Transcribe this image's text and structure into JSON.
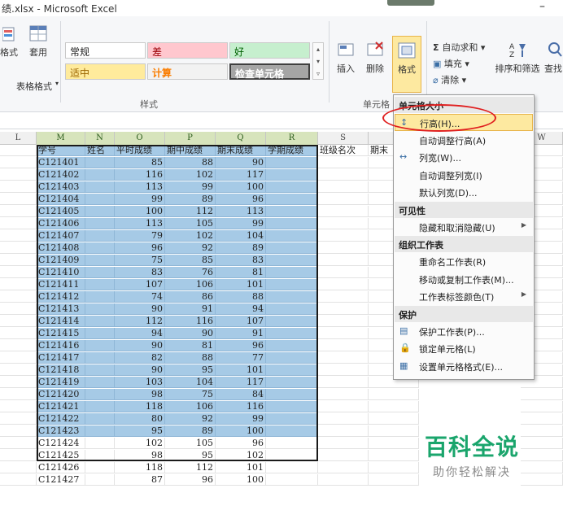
{
  "window": {
    "title": "绩.xlsx - Microsoft Excel",
    "minimize": "–"
  },
  "ribbon": {
    "left_labels": [
      "格式",
      "套用",
      "表格格式"
    ],
    "styles": {
      "cells": [
        {
          "text": "常规",
          "bg": "#ffffff",
          "color": "#222222"
        },
        {
          "text": "差",
          "bg": "#ffc7ce",
          "color": "#9c0006"
        },
        {
          "text": "好",
          "bg": "#c6efce",
          "color": "#006100"
        },
        {
          "text": "适中",
          "bg": "#ffeb9c",
          "color": "#9c6500"
        },
        {
          "text": "计算",
          "bg": "#f2f2f2",
          "color": "#fa7d00"
        },
        {
          "text": "检查单元格",
          "bg": "#a5a5a5",
          "color": "#ffffff"
        }
      ],
      "group_label": "样式"
    },
    "cells_group": {
      "insert": "插入",
      "delete": "删除",
      "format": "格式",
      "group_label": "单元格"
    },
    "editing": {
      "autosum": "自动求和",
      "fill": "填充",
      "clear": "清除",
      "sort_filter": "排序和筛选",
      "find": "查找"
    }
  },
  "sheet": {
    "col_headers": [
      {
        "label": "L",
        "sel": false
      },
      {
        "label": "M",
        "sel": true
      },
      {
        "label": "N",
        "sel": true
      },
      {
        "label": "O",
        "sel": true
      },
      {
        "label": "P",
        "sel": true
      },
      {
        "label": "Q",
        "sel": true
      },
      {
        "label": "R",
        "sel": true
      },
      {
        "label": "S",
        "sel": false
      },
      {
        "label": "W",
        "sel": false
      }
    ],
    "header_row": [
      "学号",
      "姓名",
      "平时成绩",
      "期中成绩",
      "期末成绩",
      "学期成绩",
      "班级名次",
      "期末"
    ],
    "rows": [
      [
        "C121401",
        "",
        "85",
        "88",
        "90"
      ],
      [
        "C121402",
        "",
        "116",
        "102",
        "117"
      ],
      [
        "C121403",
        "",
        "113",
        "99",
        "100"
      ],
      [
        "C121404",
        "",
        "99",
        "89",
        "96"
      ],
      [
        "C121405",
        "",
        "100",
        "112",
        "113"
      ],
      [
        "C121406",
        "",
        "113",
        "105",
        "99"
      ],
      [
        "C121407",
        "",
        "79",
        "102",
        "104"
      ],
      [
        "C121408",
        "",
        "96",
        "92",
        "89"
      ],
      [
        "C121409",
        "",
        "75",
        "85",
        "83"
      ],
      [
        "C121410",
        "",
        "83",
        "76",
        "81"
      ],
      [
        "C121411",
        "",
        "107",
        "106",
        "101"
      ],
      [
        "C121412",
        "",
        "74",
        "86",
        "88"
      ],
      [
        "C121413",
        "",
        "90",
        "91",
        "94"
      ],
      [
        "C121414",
        "",
        "112",
        "116",
        "107"
      ],
      [
        "C121415",
        "",
        "94",
        "90",
        "91"
      ],
      [
        "C121416",
        "",
        "90",
        "81",
        "96"
      ],
      [
        "C121417",
        "",
        "82",
        "88",
        "77"
      ],
      [
        "C121418",
        "",
        "90",
        "95",
        "101"
      ],
      [
        "C121419",
        "",
        "103",
        "104",
        "117"
      ],
      [
        "C121420",
        "",
        "98",
        "75",
        "84"
      ],
      [
        "C121421",
        "",
        "118",
        "106",
        "116"
      ],
      [
        "C121422",
        "",
        "80",
        "92",
        "99"
      ],
      [
        "C121423",
        "",
        "95",
        "89",
        "100"
      ],
      [
        "C121424",
        "",
        "102",
        "105",
        "96"
      ],
      [
        "C121425",
        "",
        "98",
        "95",
        "102"
      ],
      [
        "C121426",
        "",
        "118",
        "112",
        "101"
      ],
      [
        "C121427",
        "",
        "87",
        "96",
        "100"
      ]
    ],
    "selected_through_row": 23,
    "selection_color": "#a6cae6"
  },
  "format_menu": {
    "sections": [
      {
        "kind": "head",
        "text": "单元格大小"
      },
      {
        "kind": "item",
        "text": "行高(H)...",
        "icon": "row-height-icon",
        "glyph": "↕",
        "highlight": true
      },
      {
        "kind": "item",
        "text": "自动调整行高(A)"
      },
      {
        "kind": "item",
        "text": "列宽(W)...",
        "icon": "column-width-icon",
        "glyph": "↔"
      },
      {
        "kind": "item",
        "text": "自动调整列宽(I)"
      },
      {
        "kind": "item",
        "text": "默认列宽(D)..."
      },
      {
        "kind": "head",
        "text": "可见性"
      },
      {
        "kind": "item",
        "text": "隐藏和取消隐藏(U)",
        "submenu": true
      },
      {
        "kind": "head",
        "text": "组织工作表"
      },
      {
        "kind": "item",
        "text": "重命名工作表(R)"
      },
      {
        "kind": "item",
        "text": "移动或复制工作表(M)..."
      },
      {
        "kind": "item",
        "text": "工作表标签颜色(T)",
        "submenu": true
      },
      {
        "kind": "head",
        "text": "保护"
      },
      {
        "kind": "item",
        "text": "保护工作表(P)...",
        "icon": "protect-sheet-icon",
        "glyph": "▤"
      },
      {
        "kind": "item",
        "text": "锁定单元格(L)",
        "icon": "lock-cell-icon",
        "glyph": "🔒"
      },
      {
        "kind": "item",
        "text": "设置单元格格式(E)...",
        "icon": "format-cells-icon",
        "glyph": "▦"
      }
    ]
  },
  "watermark": {
    "title": "百科全说",
    "subtitle": "助你轻松解决",
    "color": "#1aa56c"
  }
}
